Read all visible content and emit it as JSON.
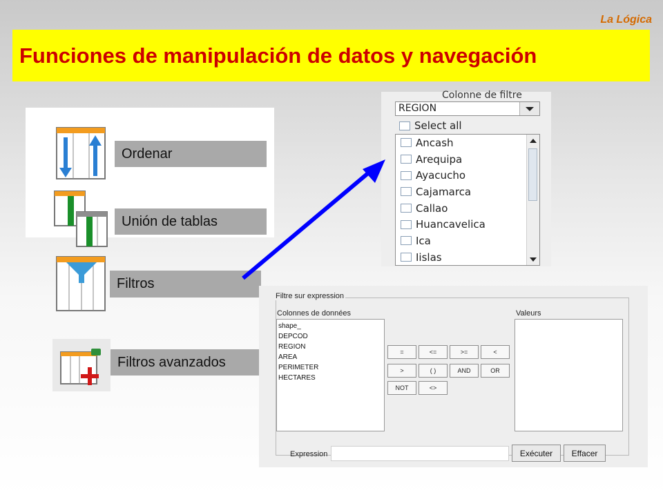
{
  "brand": "La Lógica",
  "title": "Funciones de manipulación de datos y navegación",
  "tools": [
    {
      "label": "Ordenar",
      "icon": "sort-table-icon"
    },
    {
      "label": "Unión de tablas",
      "icon": "join-tables-icon"
    },
    {
      "label": "Filtros",
      "icon": "filter-table-icon"
    },
    {
      "label": "Filtros avanzados",
      "icon": "advanced-filter-icon"
    }
  ],
  "filter_column": {
    "title": "Colonne de filtre",
    "selected": "REGION",
    "select_all": "Select all",
    "items": [
      "Ancash",
      "Arequipa",
      "Ayacucho",
      "Cajamarca",
      "Callao",
      "Huancavelica",
      "Ica",
      "Iislas"
    ]
  },
  "expression_filter": {
    "title": "Filtre sur expression",
    "columns_label": "Colonnes de données",
    "columns": [
      "shape_",
      "DEPCOD",
      "REGION",
      "AREA",
      "PERIMETER",
      "HECTARES"
    ],
    "values_label": "Valeurs",
    "operators": [
      "=",
      "<=",
      ">=",
      "<",
      ">",
      "( )",
      "AND",
      "OR",
      "NOT",
      "<>"
    ],
    "expression_label": "Expression",
    "expression_value": "",
    "execute_label": "Exécuter",
    "clear_label": "Effacer"
  },
  "colors": {
    "title_bg": "#ffff00",
    "title_text": "#cc0000",
    "brand": "#d46a00",
    "arrow": "#0000ff"
  }
}
